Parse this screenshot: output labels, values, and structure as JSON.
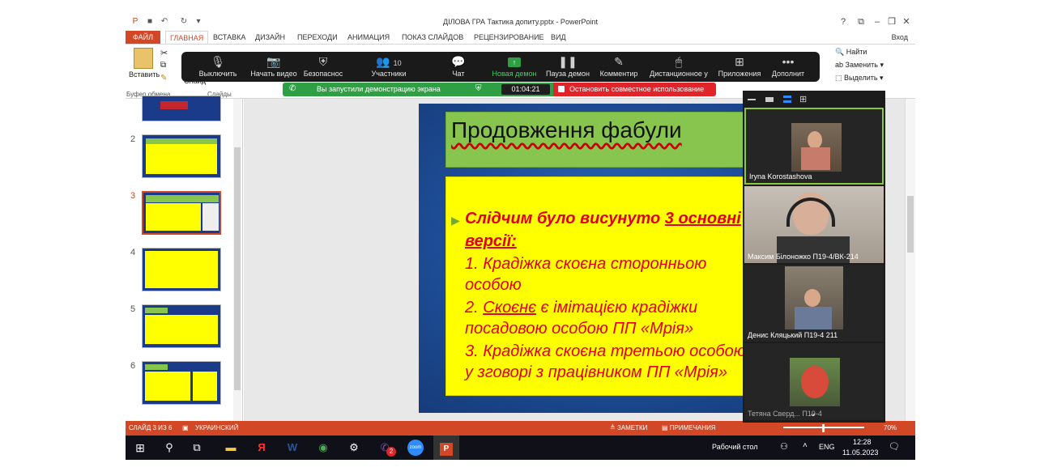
{
  "window": {
    "title": "ДІЛОВА ГРА   Тактика допиту.pptx - PowerPoint",
    "login": "Вход"
  },
  "ribbon_tabs": [
    "ФАЙЛ",
    "ГЛАВНАЯ",
    "ВСТАВКА",
    "ДИЗАЙН",
    "ПЕРЕХОДИ",
    "АНИМАЦИЯ",
    "ПОКАЗ СЛАЙДОВ",
    "РЕЦЕНЗИРОВАНИЕ",
    "ВИД"
  ],
  "ribbon": {
    "paste_label": "Вставить",
    "clipboard_group": "Буфер обмена",
    "slides_group": "Слайды",
    "new_slide_label": "Слайд",
    "find_label": "Найти",
    "replace_label": "Заменить",
    "select_label": "Выделить"
  },
  "thumbnails": {
    "items": [
      {
        "num": ""
      },
      {
        "num": "2"
      },
      {
        "num": "3"
      },
      {
        "num": "4"
      },
      {
        "num": "5"
      },
      {
        "num": "6"
      }
    ],
    "selected": "3"
  },
  "slide": {
    "title": "Продовження фабули",
    "line1_a": "Слідчим було висунуто ",
    "line1_b": "3 основні",
    "line2": "версії:",
    "item1_a": "1.    Крадіжка скоєна сторонньою",
    "item1_b": "особою",
    "item2_a": "2.     ",
    "item2_b": "Скоєнє",
    "item2_c": " є імітацією крадіжки",
    "item2_d": "посадовою особою ПП «Мрія»",
    "item3_a": "3.    Крадіжка скоєна третьою особою",
    "item3_b": "у зговорі з працівником ПП «Мрія»"
  },
  "statusbar": {
    "slide_info": "СЛАЙД 3 ИЗ 6",
    "language": "УКРАИНСКИЙ",
    "notes": "ЗАМЕТКИ",
    "comments": "ПРИМЕЧАНИЯ",
    "zoom": "70%"
  },
  "zoom_toolbar": {
    "mute": "Выключить",
    "start_video": "Начать видео",
    "security": "Безопаснос",
    "participants": "Участники",
    "participants_count": "10",
    "chat": "Чат",
    "new_share": "Новая демон",
    "pause_share": "Пауза демон",
    "annotate": "Комментир",
    "remote": "Дистанционное у",
    "apps": "Приложения",
    "more": "Дополнит"
  },
  "share_bar": {
    "status": "Вы запустили демонстрацию экрана",
    "timer": "01:04:21",
    "stop": "Остановить совместное использование"
  },
  "participants": [
    {
      "name": "Iryna Korostashova"
    },
    {
      "name": "Максим Білоножко П19-4/ВК-214"
    },
    {
      "name": "Денис Кляцький П19-4 211"
    },
    {
      "name": "Тетяна Сверд... П19-4"
    }
  ],
  "taskbar": {
    "desktop": "Рабочий стол",
    "lang": "ENG",
    "time": "12:28",
    "date": "11.05.2023",
    "viber_badge": "2"
  },
  "colors": {
    "accent": "#d24726",
    "slide_title_bg": "#88c54f",
    "slide_box_bg": "#ffff00",
    "slide_text": "#e0001b",
    "zoom_green": "#2ea043",
    "zoom_red": "#e0242a"
  }
}
